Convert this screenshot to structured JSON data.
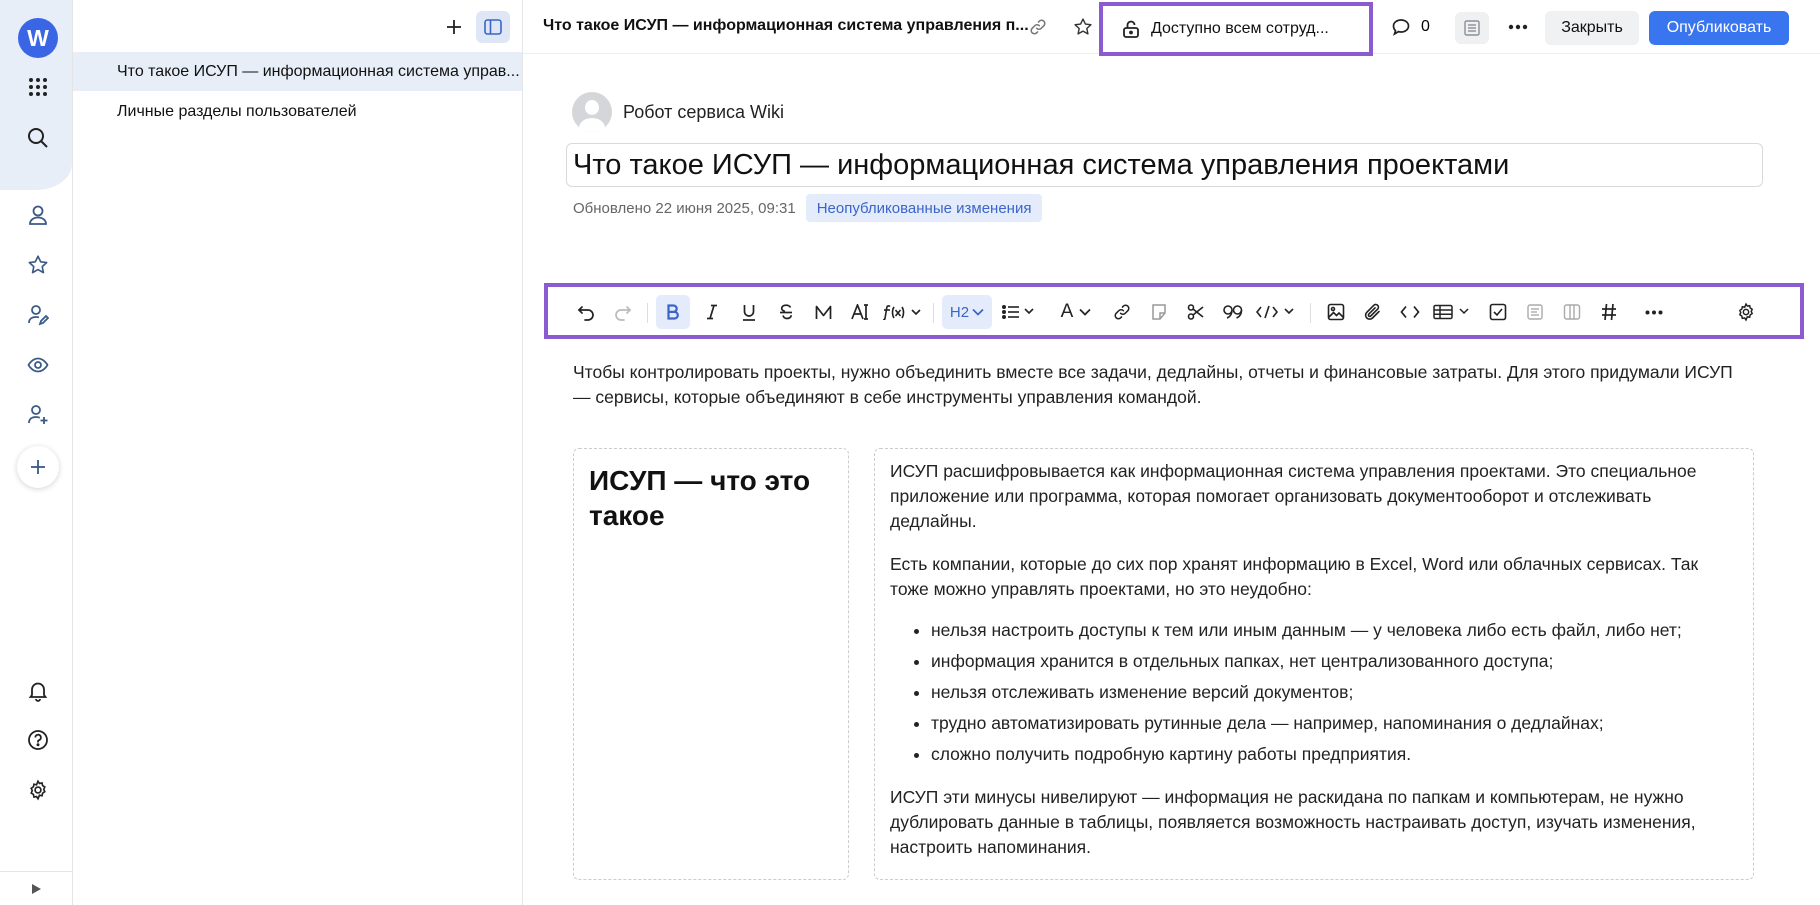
{
  "app": {
    "logo_letter": "W"
  },
  "rail": {
    "icons": [
      "apps-icon",
      "search-icon",
      "person-icon",
      "star-icon",
      "person-edit-icon",
      "eye-icon",
      "person-add-icon",
      "plus-icon",
      "bell-icon",
      "help-icon",
      "gear-icon",
      "play-icon"
    ]
  },
  "tree": {
    "items": [
      {
        "label": "Что такое ИСУП — информационная система управ...",
        "active": true
      },
      {
        "label": "Личные разделы пользователей",
        "active": false
      }
    ]
  },
  "topbar": {
    "doc_title": "Что такое ИСУП — информационная система управления п...",
    "access_label": "Доступно всем сотруд...",
    "comments_count": "0",
    "close_label": "Закрыть",
    "publish_label": "Опубликовать"
  },
  "document": {
    "author": "Робот сервиса Wiki",
    "title": "Что такое ИСУП — информационная система управления проектами",
    "updated": "Обновлено 22 июня 2025, 09:31",
    "badge": "Неопубликованные изменения",
    "intro": "Чтобы контролировать проекты, нужно объединить вместе все задачи, дедлайны, отчеты и финансовые затраты. Для этого придумали ИСУП — сервисы, которые объединяют в себе инструменты управления командой.",
    "section_heading": "ИСУП — что это такое",
    "para1": "ИСУП расшифровывается как информационная система управления проектами. Это специальное приложение или программа, которая помогает организовать документооборот и отслеживать дедлайны.",
    "para2": "Есть компании, которые до сих пор хранят информацию в Excel, Word или облачных сервисах. Так тоже можно управлять проектами, но это неудобно:",
    "bullets": [
      "нельзя настроить доступы к тем или иным данным — у человека либо есть файл, либо нет;",
      "информация хранится в отдельных папках, нет централизованного доступа;",
      "нельзя отслеживать изменение версий документов;",
      "трудно автоматизировать рутинные дела — например, напоминания о дедлайнах;",
      "сложно получить подробную картину работы предприятия."
    ],
    "para3": "ИСУП эти минусы нивелируют — информация не раскидана по папкам и компьютерам, не нужно дублировать данные в таблицы, появляется возможность настраивать доступ, изучать изменения, настроить напоминания."
  },
  "toolbar": {
    "heading_level": "H2",
    "font_label": "A",
    "items": [
      "undo",
      "redo",
      "bold",
      "italic",
      "underline",
      "strikethrough",
      "monospace",
      "text-size",
      "formula",
      "heading",
      "list",
      "text-color",
      "link",
      "note",
      "cut",
      "quote",
      "code-block",
      "image",
      "attachment",
      "inline-code",
      "table",
      "checkbox",
      "form",
      "columns",
      "hash",
      "more",
      "settings"
    ]
  },
  "colors": {
    "accent": "#3a75f0",
    "highlight_frame": "#8a5cd0",
    "rail_bg": "#e8eef8"
  }
}
